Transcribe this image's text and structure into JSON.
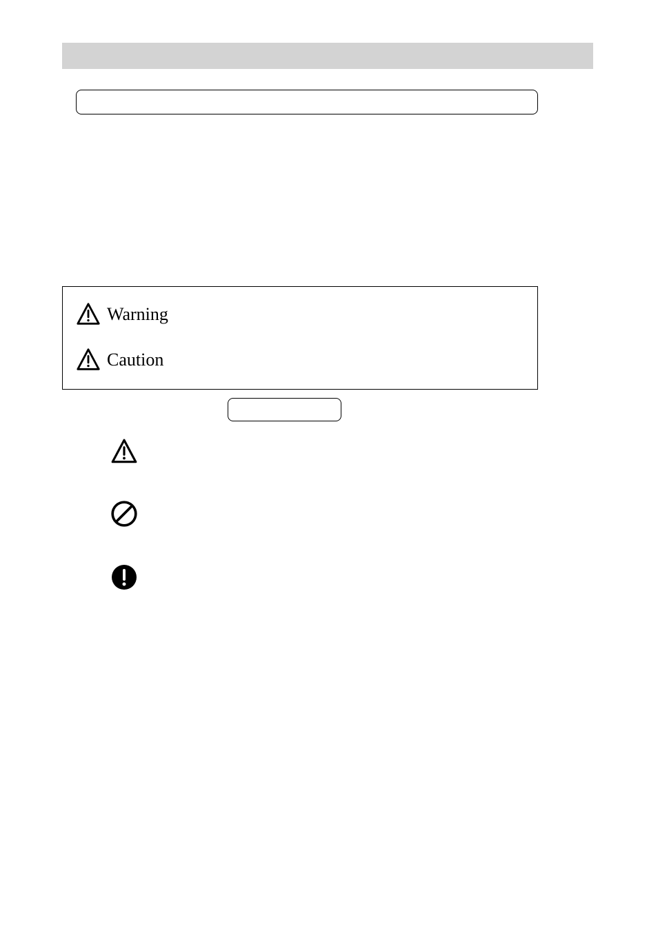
{
  "symbols": {
    "warning_label": "Warning",
    "caution_label": "Caution"
  }
}
